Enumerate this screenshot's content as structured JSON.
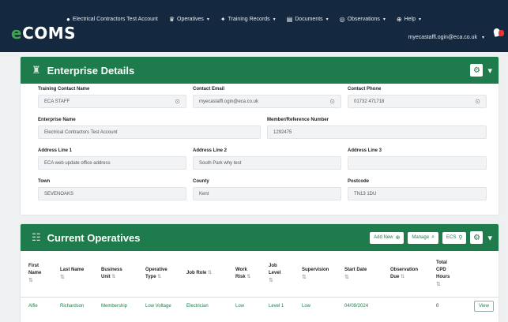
{
  "nav": {
    "logo_prefix": "e",
    "logo_main": "COMS",
    "items": [
      {
        "icon": "●",
        "label": "Electrical Contractors Test Account",
        "caret": ""
      },
      {
        "icon": "♛",
        "label": "Operatives",
        "caret": "▾"
      },
      {
        "icon": "✦",
        "label": "Training Records",
        "caret": "▾"
      },
      {
        "icon": "▤",
        "label": "Documents",
        "caret": "▾"
      },
      {
        "icon": "◎",
        "label": "Observations",
        "caret": "▾"
      },
      {
        "icon": "⊕",
        "label": "Help",
        "caret": "▾"
      }
    ],
    "user_email": "myecastaffl.ogin@eca.co.uk",
    "user_caret": "▾"
  },
  "enterprise": {
    "title": "Enterprise Details",
    "icon": "♜",
    "fields": {
      "training_contact_name": {
        "label": "Training Contact Name",
        "value": "ECA STAFF"
      },
      "contact_email": {
        "label": "Contact Email",
        "value": "myecastaffl.ogin@eca.co.uk"
      },
      "contact_phone": {
        "label": "Contact Phone",
        "value": "01732 471718"
      },
      "enterprise_name": {
        "label": "Enterprise Name",
        "value": "Electrical Contractors Test Account"
      },
      "member_ref": {
        "label": "Member/Reference Number",
        "value": "1292475"
      },
      "address1": {
        "label": "Address Line 1",
        "value": "ECA web update office address"
      },
      "address2": {
        "label": "Address Line 2",
        "value": "South Park why test"
      },
      "address3": {
        "label": "Address Line 3",
        "value": ""
      },
      "town": {
        "label": "Town",
        "value": "SEVENOAKS"
      },
      "county": {
        "label": "County",
        "value": "Kent"
      },
      "postcode": {
        "label": "Postcode",
        "value": "TN13 1DU"
      }
    }
  },
  "operatives": {
    "title": "Current Operatives",
    "icon": "☷",
    "buttons": {
      "add_new": "Add New",
      "manage": "Manage",
      "ecs": "ECS"
    },
    "sort_icon": "⇅",
    "headers": [
      [
        "First",
        "Name"
      ],
      [
        "Last Name"
      ],
      [
        "Business",
        "Unit"
      ],
      [
        "Operative",
        "Type"
      ],
      [
        "Job Role"
      ],
      [
        "Work",
        "Risk"
      ],
      [
        "Job",
        "Level"
      ],
      [
        "Supervision"
      ],
      [
        "Start Date"
      ],
      [
        "Observation",
        "Due"
      ],
      [
        "Total",
        "CPD",
        "Hours"
      ],
      [
        ""
      ]
    ],
    "rows": [
      {
        "first_name": "Alfie",
        "last_name": "Richardson",
        "business_unit": "Membership",
        "operative_type": "Low Voltage",
        "job_role": "Electrician",
        "work_risk": "Low",
        "job_level": "Level 1",
        "supervision": "Low",
        "start_date": "04/09/2024",
        "observation_due": "",
        "cpd_hours": "0",
        "action": "View"
      }
    ]
  }
}
